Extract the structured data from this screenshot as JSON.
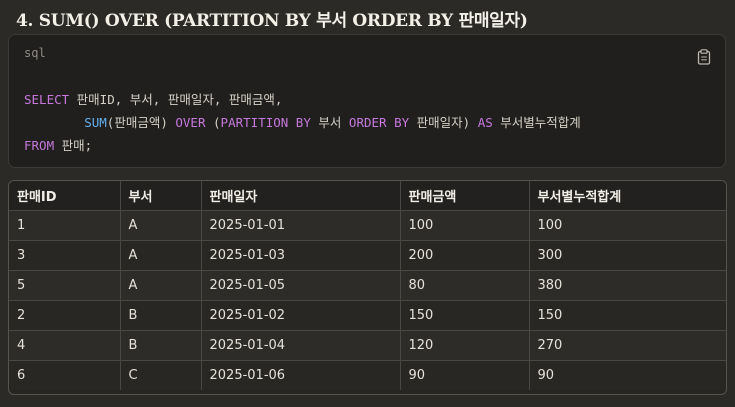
{
  "heading": "4. SUM() OVER (PARTITION BY 부서 ORDER BY 판매일자)",
  "code": {
    "language": "sql",
    "copy_icon": "clipboard-icon",
    "line1": {
      "kw_select": "SELECT",
      "rest": " 판매ID, 부서, 판매일자, 판매금액,"
    },
    "line2": {
      "indent": "        ",
      "fn_sum": "SUM",
      "arg": "(판매금액) ",
      "kw_over": "OVER",
      "open": " (",
      "kw_partition_by": "PARTITION BY",
      "part_col": " 부서 ",
      "kw_order_by": "ORDER BY",
      "order_col": " 판매일자) ",
      "kw_as": "AS",
      "alias": " 부서별누적합계"
    },
    "line3": {
      "kw_from": "FROM",
      "rest": " 판매;"
    }
  },
  "table": {
    "headers": [
      "판매ID",
      "부서",
      "판매일자",
      "판매금액",
      "부서별누적합계"
    ],
    "rows": [
      [
        "1",
        "A",
        "2025-01-01",
        "100",
        "100"
      ],
      [
        "3",
        "A",
        "2025-01-03",
        "200",
        "300"
      ],
      [
        "5",
        "A",
        "2025-01-05",
        "80",
        "380"
      ],
      [
        "2",
        "B",
        "2025-01-02",
        "150",
        "150"
      ],
      [
        "4",
        "B",
        "2025-01-04",
        "120",
        "270"
      ],
      [
        "6",
        "C",
        "2025-01-06",
        "90",
        "90"
      ]
    ]
  },
  "colors": {
    "keyword": "#c678dd",
    "function": "#61afef",
    "background": "#2b2a27"
  }
}
